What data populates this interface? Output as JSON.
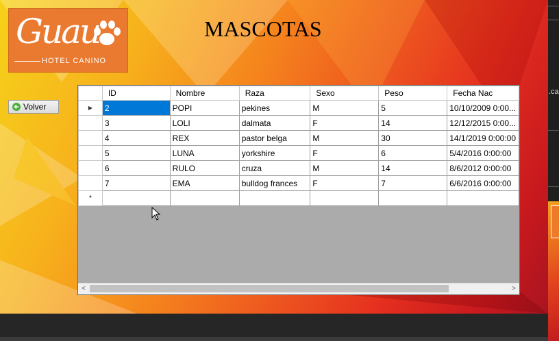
{
  "logo": {
    "brand": "Guau",
    "subtitle": "HOTEL CANINO"
  },
  "title": "MASCOTAS",
  "volver_button": {
    "label": "Volver",
    "icon": "back-arrow-icon"
  },
  "grid": {
    "columns": [
      "ID",
      "Nombre",
      "Raza",
      "Sexo",
      "Peso",
      "Fecha Nac"
    ],
    "rows": [
      [
        "2",
        "POPI",
        "pekines",
        "M",
        "5",
        "10/10/2009 0:00..."
      ],
      [
        "3",
        "LOLI",
        "dalmata",
        "F",
        "14",
        "12/12/2015 0:00..."
      ],
      [
        "4",
        "REX",
        "pastor belga",
        "M",
        "30",
        "14/1/2019 0:00:00"
      ],
      [
        "5",
        "LUNA",
        "yorkshire",
        "F",
        "6",
        "5/4/2016 0:00:00"
      ],
      [
        "6",
        "RULO",
        "cruza",
        "M",
        "14",
        "8/6/2012 0:00:00"
      ],
      [
        "7",
        "EMA",
        "bulldog frances",
        "F",
        "7",
        "6/6/2016 0:00:00"
      ]
    ],
    "current_row_marker": "▶",
    "new_row_marker": "*",
    "scroll_left": "<",
    "scroll_right": ">"
  },
  "side_text": ".ca",
  "colors": {
    "selection": "#0078d7",
    "logo_bg": "#ea7a2f"
  }
}
